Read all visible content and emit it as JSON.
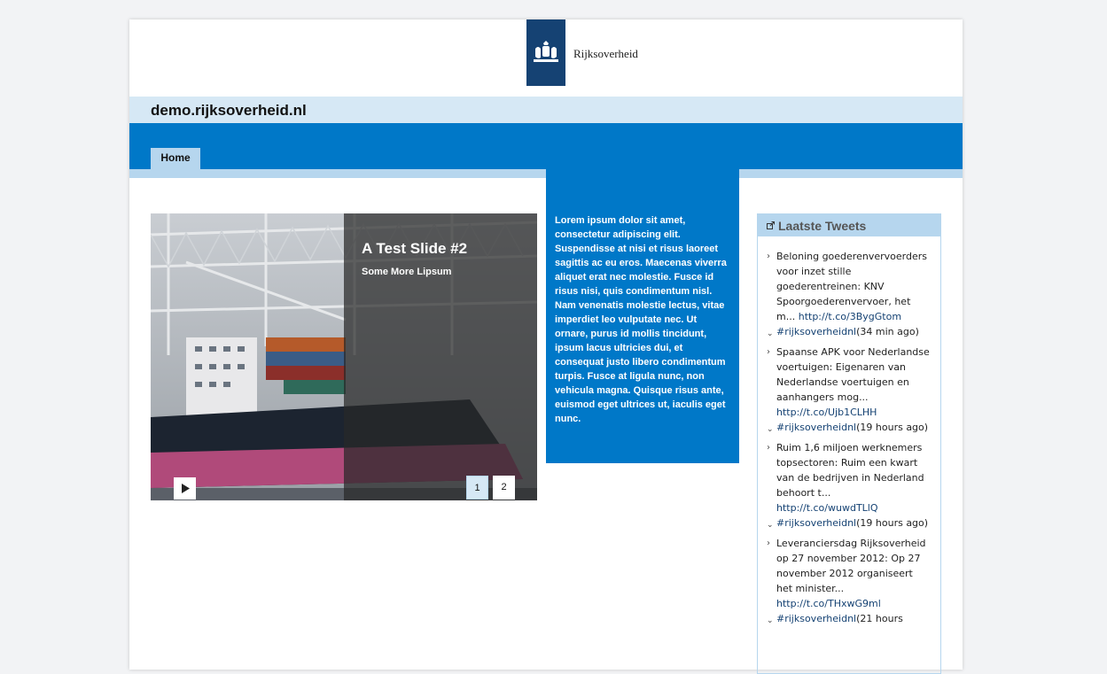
{
  "header": {
    "logo_text": "Rijksoverheid",
    "site_title": "demo.rijksoverheid.nl"
  },
  "nav": {
    "home_label": "Home"
  },
  "slider": {
    "title": "A Test Slide #2",
    "subtitle": "Some More Lipsum",
    "pages": [
      "1",
      "2"
    ],
    "active_page": "1"
  },
  "content": {
    "text": "Lorem ipsum dolor sit amet, consectetur adipiscing elit. Suspendisse at nisi et risus laoreet sagittis ac eu eros. Maecenas viverra aliquet erat nec molestie. Fusce id risus nisi, quis condimentum nisl. Nam venenatis molestie lectus, vitae imperdiet leo vulputate nec. Ut ornare, purus id mollis tincidunt, ipsum lacus ultricies dui, et consequat justo libero condimentum turpis. Fusce at ligula nunc, non vehicula magna. Quisque risus ante, euismod eget ultrices ut, iaculis eget nunc."
  },
  "tweets": {
    "title": "Laatste Tweets",
    "items": [
      {
        "text": "Beloning goederenvervoerders voor inzet stille goederentreinen: KNV Spoorgoederenvervoer, het m...",
        "link": "http://t.co/3BygGtom",
        "tag": "#rijksoverheidnl",
        "time": "(34 min ago)"
      },
      {
        "text": "Spaanse APK voor Nederlandse voertuigen: Eigenaren van Nederlandse voertuigen en aanhangers mog...",
        "link": "http://t.co/Ujb1CLHH",
        "tag": "#rijksoverheidnl",
        "time": "(19 hours ago)"
      },
      {
        "text": "Ruim 1,6 miljoen werknemers topsectoren: Ruim een kwart van de bedrijven in Nederland behoort t...",
        "link": "http://t.co/wuwdTLlQ",
        "tag": "#rijksoverheidnl",
        "time": "(19 hours ago)"
      },
      {
        "text": "Leveranciersdag Rijksoverheid op 27 november 2012: Op 27 november 2012 organiseert het minister...",
        "link": "http://t.co/THxwG9ml",
        "tag": "#rijksoverheidnl",
        "time": "(21 hours"
      }
    ]
  },
  "colors": {
    "brand_dark": "#154273",
    "brand_blue": "#0078c8",
    "light_blue": "#d6e8f5",
    "tab_blue": "#b6d6ee"
  }
}
